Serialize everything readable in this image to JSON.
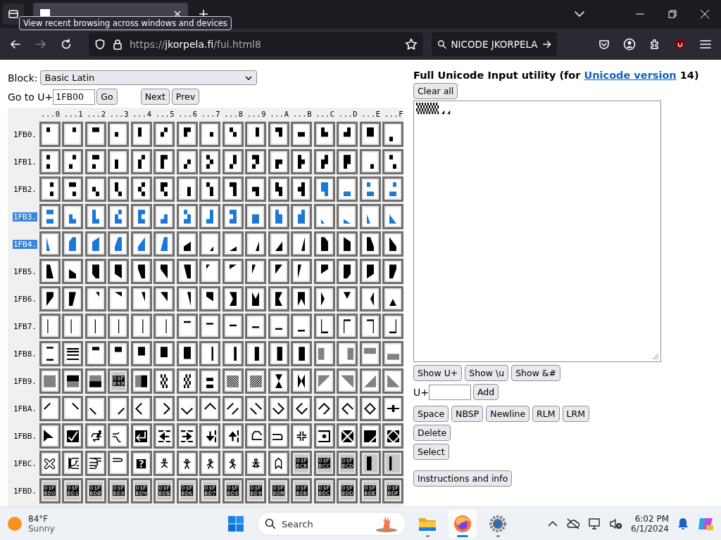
{
  "browser": {
    "tooltip": "View recent browsing across windows and devices",
    "url": {
      "scheme": "https://",
      "host": "jkorpela.fi",
      "path": "/fui.html8"
    },
    "search_value": "NICODE JKORPELA",
    "forward_disabled": true
  },
  "block": {
    "label": "Block:",
    "value": "Basic Latin"
  },
  "goto": {
    "label": "Go to U+",
    "value": "1FB00",
    "go": "Go",
    "next": "Next",
    "prev": "Prev"
  },
  "grid": {
    "columns": [
      "...0",
      "...1",
      "...2",
      "...3",
      "...4",
      "...5",
      "...6",
      "...7",
      "...8",
      "...9",
      "...A",
      "...B",
      "...C",
      "...D",
      "...E",
      "...F"
    ],
    "rows": [
      {
        "label": "1FB0.",
        "selected": false,
        "cells": [
          {
            "char": "🬀",
            "assigned": true,
            "selected": false
          },
          {
            "char": "🬁",
            "assigned": true,
            "selected": false
          },
          {
            "char": "🬂",
            "assigned": true,
            "selected": false
          },
          {
            "char": "🬃",
            "assigned": true,
            "selected": false
          },
          {
            "char": "🬄",
            "assigned": true,
            "selected": false
          },
          {
            "char": "🬅",
            "assigned": true,
            "selected": false
          },
          {
            "char": "🬆",
            "assigned": true,
            "selected": false
          },
          {
            "char": "🬇",
            "assigned": true,
            "selected": false
          },
          {
            "char": "🬈",
            "assigned": true,
            "selected": false
          },
          {
            "char": "🬉",
            "assigned": true,
            "selected": false
          },
          {
            "char": "🬊",
            "assigned": true,
            "selected": false
          },
          {
            "char": "🬋",
            "assigned": true,
            "selected": false
          },
          {
            "char": "🬌",
            "assigned": true,
            "selected": false
          },
          {
            "char": "🬍",
            "assigned": true,
            "selected": false
          },
          {
            "char": "🬎",
            "assigned": true,
            "selected": false
          },
          {
            "char": "🬏",
            "assigned": true,
            "selected": false
          }
        ]
      },
      {
        "label": "1FB1.",
        "selected": false,
        "cells": [
          {
            "char": "🬐",
            "assigned": true,
            "selected": false
          },
          {
            "char": "🬑",
            "assigned": true,
            "selected": false
          },
          {
            "char": "🬒",
            "assigned": true,
            "selected": false
          },
          {
            "char": "🬓",
            "assigned": true,
            "selected": false
          },
          {
            "char": "🬔",
            "assigned": true,
            "selected": false
          },
          {
            "char": "🬕",
            "assigned": true,
            "selected": false
          },
          {
            "char": "🬖",
            "assigned": true,
            "selected": false
          },
          {
            "char": "🬗",
            "assigned": true,
            "selected": false
          },
          {
            "char": "🬘",
            "assigned": true,
            "selected": false
          },
          {
            "char": "🬙",
            "assigned": true,
            "selected": false
          },
          {
            "char": "🬚",
            "assigned": true,
            "selected": false
          },
          {
            "char": "🬛",
            "assigned": true,
            "selected": false
          },
          {
            "char": "🬜",
            "assigned": true,
            "selected": false
          },
          {
            "char": "🬝",
            "assigned": true,
            "selected": false
          },
          {
            "char": "🬞",
            "assigned": true,
            "selected": false
          },
          {
            "char": "🬟",
            "assigned": true,
            "selected": false
          }
        ]
      },
      {
        "label": "1FB2.",
        "selected": false,
        "cells": [
          {
            "char": "🬠",
            "assigned": true,
            "selected": false
          },
          {
            "char": "🬡",
            "assigned": true,
            "selected": false
          },
          {
            "char": "🬢",
            "assigned": true,
            "selected": false
          },
          {
            "char": "🬣",
            "assigned": true,
            "selected": false
          },
          {
            "char": "🬤",
            "assigned": true,
            "selected": false
          },
          {
            "char": "🬥",
            "assigned": true,
            "selected": false
          },
          {
            "char": "🬦",
            "assigned": true,
            "selected": false
          },
          {
            "char": "🬧",
            "assigned": true,
            "selected": false
          },
          {
            "char": "🬨",
            "assigned": true,
            "selected": false
          },
          {
            "char": "🬩",
            "assigned": true,
            "selected": false
          },
          {
            "char": "🬪",
            "assigned": true,
            "selected": false
          },
          {
            "char": "🬫",
            "assigned": true,
            "selected": false
          },
          {
            "char": "🬬",
            "assigned": true,
            "selected": true
          },
          {
            "char": "🬭",
            "assigned": true,
            "selected": true
          },
          {
            "char": "🬮",
            "assigned": true,
            "selected": true
          },
          {
            "char": "🬯",
            "assigned": true,
            "selected": true
          }
        ]
      },
      {
        "label": "1FB3.",
        "selected": true,
        "cells": [
          {
            "char": "🬰",
            "assigned": true,
            "selected": true
          },
          {
            "char": "🬱",
            "assigned": true,
            "selected": true
          },
          {
            "char": "🬲",
            "assigned": true,
            "selected": true
          },
          {
            "char": "🬳",
            "assigned": true,
            "selected": true
          },
          {
            "char": "🬴",
            "assigned": true,
            "selected": true
          },
          {
            "char": "🬵",
            "assigned": true,
            "selected": true
          },
          {
            "char": "🬶",
            "assigned": true,
            "selected": true
          },
          {
            "char": "🬷",
            "assigned": true,
            "selected": true
          },
          {
            "char": "🬸",
            "assigned": true,
            "selected": true
          },
          {
            "char": "🬹",
            "assigned": true,
            "selected": true
          },
          {
            "char": "🬺",
            "assigned": true,
            "selected": true
          },
          {
            "char": "🬻",
            "assigned": true,
            "selected": true
          },
          {
            "char": "🬼",
            "assigned": true,
            "selected": true
          },
          {
            "char": "🬽",
            "assigned": true,
            "selected": true
          },
          {
            "char": "🬾",
            "assigned": true,
            "selected": true
          },
          {
            "char": "🬿",
            "assigned": true,
            "selected": true
          }
        ]
      },
      {
        "label": "1FB4.",
        "selected": true,
        "cells": [
          {
            "char": "🭀",
            "assigned": true,
            "selected": true
          },
          {
            "char": "🭁",
            "assigned": true,
            "selected": true
          },
          {
            "char": "🭂",
            "assigned": true,
            "selected": true
          },
          {
            "char": "🭃",
            "assigned": true,
            "selected": true
          },
          {
            "char": "🭄",
            "assigned": true,
            "selected": true
          },
          {
            "char": "🭅",
            "assigned": true,
            "selected": true
          },
          {
            "char": "🭆",
            "assigned": true,
            "selected": false
          },
          {
            "char": "🭇",
            "assigned": true,
            "selected": false
          },
          {
            "char": "🭈",
            "assigned": true,
            "selected": false
          },
          {
            "char": "🭉",
            "assigned": true,
            "selected": false
          },
          {
            "char": "🭊",
            "assigned": true,
            "selected": false
          },
          {
            "char": "🭋",
            "assigned": true,
            "selected": false
          },
          {
            "char": "🭌",
            "assigned": true,
            "selected": false
          },
          {
            "char": "🭍",
            "assigned": true,
            "selected": false
          },
          {
            "char": "🭎",
            "assigned": true,
            "selected": false
          },
          {
            "char": "🭏",
            "assigned": true,
            "selected": false
          }
        ]
      },
      {
        "label": "1FB5.",
        "selected": false,
        "cells": [
          {
            "char": "🭐",
            "assigned": true,
            "selected": false
          },
          {
            "char": "🭑",
            "assigned": true,
            "selected": false
          },
          {
            "char": "🭒",
            "assigned": true,
            "selected": false
          },
          {
            "char": "🭓",
            "assigned": true,
            "selected": false
          },
          {
            "char": "🭔",
            "assigned": true,
            "selected": false
          },
          {
            "char": "🭕",
            "assigned": true,
            "selected": false
          },
          {
            "char": "🭖",
            "assigned": true,
            "selected": false
          },
          {
            "char": "🭗",
            "assigned": true,
            "selected": false
          },
          {
            "char": "🭘",
            "assigned": true,
            "selected": false
          },
          {
            "char": "🭙",
            "assigned": true,
            "selected": false
          },
          {
            "char": "🭚",
            "assigned": true,
            "selected": false
          },
          {
            "char": "🭛",
            "assigned": true,
            "selected": false
          },
          {
            "char": "🭜",
            "assigned": true,
            "selected": false
          },
          {
            "char": "🭝",
            "assigned": true,
            "selected": false
          },
          {
            "char": "🭞",
            "assigned": true,
            "selected": false
          },
          {
            "char": "🭟",
            "assigned": true,
            "selected": false
          }
        ]
      },
      {
        "label": "1FB6.",
        "selected": false,
        "cells": [
          {
            "char": "🭠",
            "assigned": true,
            "selected": false
          },
          {
            "char": "🭡",
            "assigned": true,
            "selected": false
          },
          {
            "char": "🭢",
            "assigned": true,
            "selected": false
          },
          {
            "char": "🭣",
            "assigned": true,
            "selected": false
          },
          {
            "char": "🭤",
            "assigned": true,
            "selected": false
          },
          {
            "char": "🭥",
            "assigned": true,
            "selected": false
          },
          {
            "char": "🭦",
            "assigned": true,
            "selected": false
          },
          {
            "char": "🭧",
            "assigned": true,
            "selected": false
          },
          {
            "char": "🭨",
            "assigned": true,
            "selected": false
          },
          {
            "char": "🭩",
            "assigned": true,
            "selected": false
          },
          {
            "char": "🭪",
            "assigned": true,
            "selected": false
          },
          {
            "char": "🭫",
            "assigned": true,
            "selected": false
          },
          {
            "char": "🭬",
            "assigned": true,
            "selected": false
          },
          {
            "char": "🭭",
            "assigned": true,
            "selected": false
          },
          {
            "char": "🭮",
            "assigned": true,
            "selected": false
          },
          {
            "char": "🭯",
            "assigned": true,
            "selected": false
          }
        ]
      },
      {
        "label": "1FB7.",
        "selected": false,
        "cells": [
          {
            "char": "🭰",
            "assigned": true,
            "selected": false
          },
          {
            "char": "🭱",
            "assigned": true,
            "selected": false
          },
          {
            "char": "🭲",
            "assigned": true,
            "selected": false
          },
          {
            "char": "🭳",
            "assigned": true,
            "selected": false
          },
          {
            "char": "🭴",
            "assigned": true,
            "selected": false
          },
          {
            "char": "🭵",
            "assigned": true,
            "selected": false
          },
          {
            "char": "🭶",
            "assigned": true,
            "selected": false
          },
          {
            "char": "🭷",
            "assigned": true,
            "selected": false
          },
          {
            "char": "🭸",
            "assigned": true,
            "selected": false
          },
          {
            "char": "🭹",
            "assigned": true,
            "selected": false
          },
          {
            "char": "🭺",
            "assigned": true,
            "selected": false
          },
          {
            "char": "🭻",
            "assigned": true,
            "selected": false
          },
          {
            "char": "🭼",
            "assigned": true,
            "selected": false
          },
          {
            "char": "🭽",
            "assigned": true,
            "selected": false
          },
          {
            "char": "🭾",
            "assigned": true,
            "selected": false
          },
          {
            "char": "🭿",
            "assigned": true,
            "selected": false
          }
        ]
      },
      {
        "label": "1FB8.",
        "selected": false,
        "cells": [
          {
            "char": "🮀",
            "assigned": true,
            "selected": false
          },
          {
            "char": "🮁",
            "assigned": true,
            "selected": false
          },
          {
            "char": "🮂",
            "assigned": true,
            "selected": false
          },
          {
            "char": "🮃",
            "assigned": true,
            "selected": false
          },
          {
            "char": "🮄",
            "assigned": true,
            "selected": false
          },
          {
            "char": "🮅",
            "assigned": true,
            "selected": false
          },
          {
            "char": "🮆",
            "assigned": true,
            "selected": false
          },
          {
            "char": "🮇",
            "assigned": true,
            "selected": false
          },
          {
            "char": "🮈",
            "assigned": true,
            "selected": false
          },
          {
            "char": "🮉",
            "assigned": true,
            "selected": false
          },
          {
            "char": "🮊",
            "assigned": true,
            "selected": false
          },
          {
            "char": "🮋",
            "assigned": true,
            "selected": false
          },
          {
            "char": "🮌",
            "assigned": true,
            "selected": false
          },
          {
            "char": "🮍",
            "assigned": true,
            "selected": false
          },
          {
            "char": "🮎",
            "assigned": true,
            "selected": false
          },
          {
            "char": "🮏",
            "assigned": true,
            "selected": false
          }
        ]
      },
      {
        "label": "1FB9.",
        "selected": false,
        "cells": [
          {
            "char": "🮐",
            "assigned": true,
            "selected": false
          },
          {
            "char": "🮑",
            "assigned": true,
            "selected": false
          },
          {
            "char": "🮒",
            "assigned": true,
            "selected": false
          },
          {
            "char": "🮓",
            "assigned": false,
            "selected": false
          },
          {
            "char": "🮔",
            "assigned": true,
            "selected": false
          },
          {
            "char": "🮕",
            "assigned": true,
            "selected": false
          },
          {
            "char": "🮖",
            "assigned": true,
            "selected": false
          },
          {
            "char": "🮗",
            "assigned": true,
            "selected": false
          },
          {
            "char": "🮘",
            "assigned": true,
            "selected": false
          },
          {
            "char": "🮙",
            "assigned": true,
            "selected": false
          },
          {
            "char": "🮚",
            "assigned": true,
            "selected": false
          },
          {
            "char": "🮛",
            "assigned": true,
            "selected": false
          },
          {
            "char": "🮜",
            "assigned": true,
            "selected": false
          },
          {
            "char": "🮝",
            "assigned": true,
            "selected": false
          },
          {
            "char": "🮞",
            "assigned": true,
            "selected": false
          },
          {
            "char": "🮟",
            "assigned": true,
            "selected": false
          }
        ]
      },
      {
        "label": "1FBA.",
        "selected": false,
        "cells": [
          {
            "char": "🮠",
            "assigned": true,
            "selected": false
          },
          {
            "char": "🮡",
            "assigned": true,
            "selected": false
          },
          {
            "char": "🮢",
            "assigned": true,
            "selected": false
          },
          {
            "char": "🮣",
            "assigned": true,
            "selected": false
          },
          {
            "char": "🮤",
            "assigned": true,
            "selected": false
          },
          {
            "char": "🮥",
            "assigned": true,
            "selected": false
          },
          {
            "char": "🮦",
            "assigned": true,
            "selected": false
          },
          {
            "char": "🮧",
            "assigned": true,
            "selected": false
          },
          {
            "char": "🮨",
            "assigned": true,
            "selected": false
          },
          {
            "char": "🮩",
            "assigned": true,
            "selected": false
          },
          {
            "char": "🮪",
            "assigned": true,
            "selected": false
          },
          {
            "char": "🮫",
            "assigned": true,
            "selected": false
          },
          {
            "char": "🮬",
            "assigned": true,
            "selected": false
          },
          {
            "char": "🮭",
            "assigned": true,
            "selected": false
          },
          {
            "char": "🮮",
            "assigned": true,
            "selected": false
          },
          {
            "char": "🮯",
            "assigned": true,
            "selected": false
          }
        ]
      },
      {
        "label": "1FBB.",
        "selected": false,
        "cells": [
          {
            "char": "🮰",
            "assigned": true,
            "selected": false
          },
          {
            "char": "🮱",
            "assigned": true,
            "selected": false
          },
          {
            "char": "🮲",
            "assigned": true,
            "selected": false
          },
          {
            "char": "🮳",
            "assigned": true,
            "selected": false
          },
          {
            "char": "🮴",
            "assigned": true,
            "selected": false
          },
          {
            "char": "🮵",
            "assigned": true,
            "selected": false
          },
          {
            "char": "🮶",
            "assigned": true,
            "selected": false
          },
          {
            "char": "🮷",
            "assigned": true,
            "selected": false
          },
          {
            "char": "🮸",
            "assigned": true,
            "selected": false
          },
          {
            "char": "🮹",
            "assigned": true,
            "selected": false
          },
          {
            "char": "🮺",
            "assigned": true,
            "selected": false
          },
          {
            "char": "🮻",
            "assigned": true,
            "selected": false
          },
          {
            "char": "🮼",
            "assigned": true,
            "selected": false
          },
          {
            "char": "🮽",
            "assigned": true,
            "selected": false
          },
          {
            "char": "🮾",
            "assigned": true,
            "selected": false
          },
          {
            "char": "🮿",
            "assigned": true,
            "selected": false
          }
        ]
      },
      {
        "label": "1FBC.",
        "selected": false,
        "cells": [
          {
            "char": "🯀",
            "assigned": true,
            "selected": false
          },
          {
            "char": "🯁",
            "assigned": true,
            "selected": false
          },
          {
            "char": "🯂",
            "assigned": true,
            "selected": false
          },
          {
            "char": "🯃",
            "assigned": true,
            "selected": false
          },
          {
            "char": "🯄",
            "assigned": true,
            "selected": false
          },
          {
            "char": "🯅",
            "assigned": true,
            "selected": false
          },
          {
            "char": "🯆",
            "assigned": true,
            "selected": false
          },
          {
            "char": "🯇",
            "assigned": true,
            "selected": false
          },
          {
            "char": "🯈",
            "assigned": true,
            "selected": false
          },
          {
            "char": "🯉",
            "assigned": true,
            "selected": false
          },
          {
            "char": "🯊",
            "assigned": true,
            "selected": false
          },
          {
            "char": "🯋",
            "assigned": false,
            "selected": false
          },
          {
            "char": "🯌",
            "assigned": false,
            "selected": false
          },
          {
            "char": "🯍",
            "assigned": false,
            "selected": false
          },
          {
            "char": "🯎",
            "assigned": false,
            "selected": false
          },
          {
            "char": "🯏",
            "assigned": false,
            "selected": false
          }
        ]
      },
      {
        "label": "1FBD.",
        "selected": false,
        "cells": [
          {
            "char": "🯐",
            "assigned": false,
            "selected": false
          },
          {
            "char": "🯑",
            "assigned": false,
            "selected": false
          },
          {
            "char": "🯒",
            "assigned": false,
            "selected": false
          },
          {
            "char": "🯓",
            "assigned": false,
            "selected": false
          },
          {
            "char": "🯔",
            "assigned": false,
            "selected": false
          },
          {
            "char": "🯕",
            "assigned": false,
            "selected": false
          },
          {
            "char": "🯖",
            "assigned": false,
            "selected": false
          },
          {
            "char": "🯗",
            "assigned": false,
            "selected": false
          },
          {
            "char": "🯘",
            "assigned": false,
            "selected": false
          },
          {
            "char": "🯙",
            "assigned": false,
            "selected": false
          },
          {
            "char": "🯚",
            "assigned": false,
            "selected": false
          },
          {
            "char": "🯛",
            "assigned": false,
            "selected": false
          },
          {
            "char": "🯜",
            "assigned": false,
            "selected": false
          },
          {
            "char": "🯝",
            "assigned": false,
            "selected": false
          },
          {
            "char": "🯞",
            "assigned": false,
            "selected": false
          },
          {
            "char": "🯟",
            "assigned": false,
            "selected": false
          }
        ]
      }
    ]
  },
  "utility": {
    "title": "Full Unicode Input utility (for ",
    "title_link": "Unicode version",
    "title_end": " 14)",
    "clear": "Clear all",
    "text": "🮕🮕🮕🮕🭇🭇",
    "show_buttons": [
      "Show U+",
      "Show \\u",
      "Show &#"
    ],
    "add_label": "U+",
    "add_button": "Add",
    "insert_buttons": [
      "Space",
      "NBSP",
      "Newline",
      "RLM",
      "LRM"
    ],
    "delete": "Delete",
    "select": "Select",
    "info": "Instructions and info"
  },
  "taskbar": {
    "temperature": "84°F",
    "condition": "Sunny",
    "search_placeholder": "Search",
    "apps": [
      {
        "kind": "files",
        "active": false
      },
      {
        "kind": "browser",
        "active": true
      },
      {
        "kind": "settings",
        "active": false
      }
    ],
    "time": "6:02 PM",
    "date": "6/1/2024"
  }
}
